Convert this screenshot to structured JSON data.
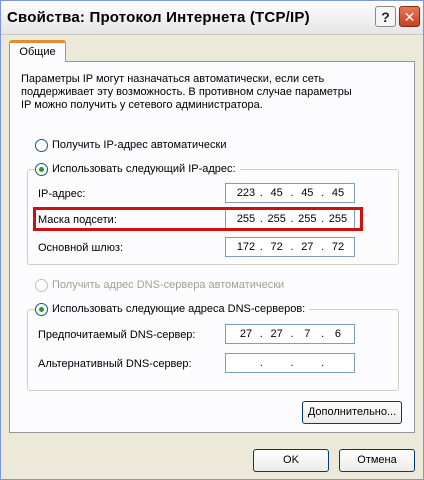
{
  "window": {
    "title": "Свойства: Протокол Интернета (TCP/IP)",
    "help_label": "?",
    "close_label": "✕"
  },
  "tabs": [
    {
      "label": "Общие",
      "active": true
    }
  ],
  "description": [
    "Параметры IP могут назначаться автоматически, если сеть",
    "поддерживает эту возможность. В противном случае параметры",
    "IP можно получить у сетевого администратора."
  ],
  "ip": {
    "auto_label": "Получить IP-адрес автоматически",
    "manual_label": "Использовать следующий IP-адрес:",
    "auto_selected": false,
    "fields": {
      "address": {
        "label": "IP-адрес:",
        "octets": [
          "223",
          "45",
          "45",
          "45"
        ]
      },
      "subnet": {
        "label": "Маска подсети:",
        "octets": [
          "255",
          "255",
          "255",
          "255"
        ]
      },
      "gateway": {
        "label": "Основной шлюз:",
        "octets": [
          "172",
          "72",
          "27",
          "72"
        ]
      }
    }
  },
  "dns": {
    "auto_label": "Получить адрес DNS-сервера автоматически",
    "manual_label": "Использовать следующие адреса DNS-серверов:",
    "auto_enabled": false,
    "fields": {
      "preferred": {
        "label": "Предпочитаемый DNS-сервер:",
        "octets": [
          "27",
          "27",
          "7",
          "6"
        ]
      },
      "alternate": {
        "label": "Альтернативный DNS-сервер:",
        "octets": [
          "",
          "",
          "",
          ""
        ]
      }
    }
  },
  "buttons": {
    "advanced": "Дополнительно...",
    "ok": "OK",
    "cancel": "Отмена"
  },
  "colors": {
    "highlight": "#d01010",
    "tab_accent": "#e68b2c",
    "radio_dot": "#21a121"
  }
}
